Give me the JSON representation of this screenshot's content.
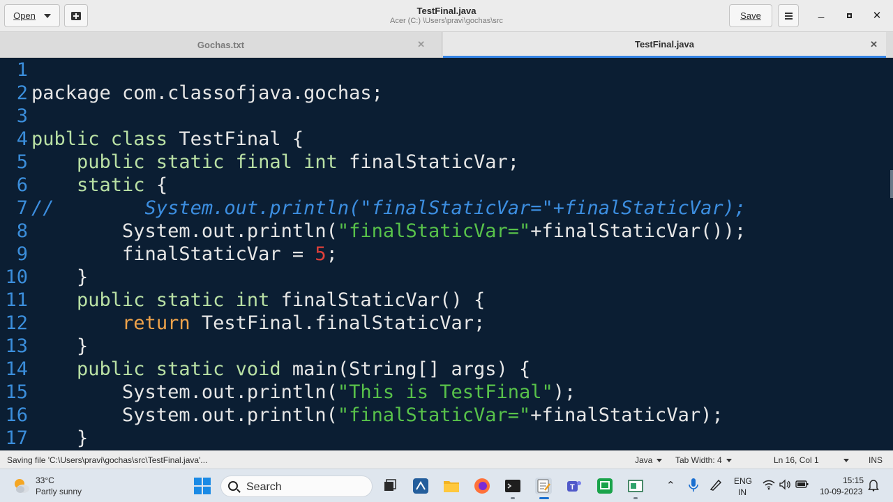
{
  "header": {
    "open_label": "Open",
    "title": "TestFinal.java",
    "subtitle": "Acer (C:) \\Users\\pravi\\gochas\\src",
    "save_label": "Save"
  },
  "tabs": [
    {
      "label": "Gochas.txt",
      "active": false
    },
    {
      "label": "TestFinal.java",
      "active": true
    }
  ],
  "editor": {
    "line_numbers": [
      "1",
      "2",
      "3",
      "4",
      "5",
      "6",
      "7",
      "8",
      "9",
      "10",
      "11",
      "12",
      "13",
      "14",
      "15",
      "16",
      "17"
    ],
    "lines": [
      [],
      [
        {
          "t": "package com.classofjava.gochas;",
          "c": "plain"
        }
      ],
      [],
      [
        {
          "t": "public class ",
          "c": "kw"
        },
        {
          "t": "TestFinal {",
          "c": "plain"
        }
      ],
      [
        {
          "t": "    public static final int ",
          "c": "kw"
        },
        {
          "t": "finalStaticVar;",
          "c": "plain"
        }
      ],
      [
        {
          "t": "    static ",
          "c": "kw"
        },
        {
          "t": "{",
          "c": "plain"
        }
      ],
      [
        {
          "t": "//        System.out.println(\"finalStaticVar=\"+finalStaticVar);",
          "c": "cmt"
        }
      ],
      [
        {
          "t": "        System.out.println(",
          "c": "plain"
        },
        {
          "t": "\"finalStaticVar=\"",
          "c": "str"
        },
        {
          "t": "+finalStaticVar());",
          "c": "plain"
        }
      ],
      [
        {
          "t": "        finalStaticVar = ",
          "c": "plain"
        },
        {
          "t": "5",
          "c": "num"
        },
        {
          "t": ";",
          "c": "plain"
        }
      ],
      [
        {
          "t": "    }",
          "c": "plain"
        }
      ],
      [
        {
          "t": "    public static int ",
          "c": "kw"
        },
        {
          "t": "finalStaticVar() {",
          "c": "plain"
        }
      ],
      [
        {
          "t": "        ",
          "c": "plain"
        },
        {
          "t": "return ",
          "c": "ret"
        },
        {
          "t": "TestFinal.finalStaticVar;",
          "c": "plain"
        }
      ],
      [
        {
          "t": "    }",
          "c": "plain"
        }
      ],
      [
        {
          "t": "    public static void ",
          "c": "kw"
        },
        {
          "t": "main(String[] args) {",
          "c": "plain"
        }
      ],
      [
        {
          "t": "        System.out.println(",
          "c": "plain"
        },
        {
          "t": "\"This is TestFinal\"",
          "c": "str"
        },
        {
          "t": ");",
          "c": "plain"
        }
      ],
      [
        {
          "t": "        System.out.println(",
          "c": "plain"
        },
        {
          "t": "\"finalStaticVar=\"",
          "c": "str"
        },
        {
          "t": "+finalStaticVar);",
          "c": "plain"
        }
      ],
      [
        {
          "t": "    }",
          "c": "plain"
        }
      ]
    ]
  },
  "statusbar": {
    "message": "Saving file 'C:\\Users\\pravi\\gochas\\src\\TestFinal.java'...",
    "language": "Java",
    "tab_width": "Tab Width: 4",
    "position": "Ln 16, Col 1",
    "mode": "INS"
  },
  "taskbar": {
    "weather_temp": "33°C",
    "weather_desc": "Partly sunny",
    "search_label": "Search",
    "lang_line1": "ENG",
    "lang_line2": "IN",
    "time": "15:15",
    "date": "10-09-2023"
  },
  "colors": {
    "editor_bg": "#0b1e33",
    "line_number": "#3b8edb",
    "keyword": "#b9e0a4",
    "string": "#58c24a",
    "number": "#e0403a",
    "comment": "#3c8ee0",
    "return_keyword": "#f0a34a",
    "tab_accent": "#3584e4"
  }
}
